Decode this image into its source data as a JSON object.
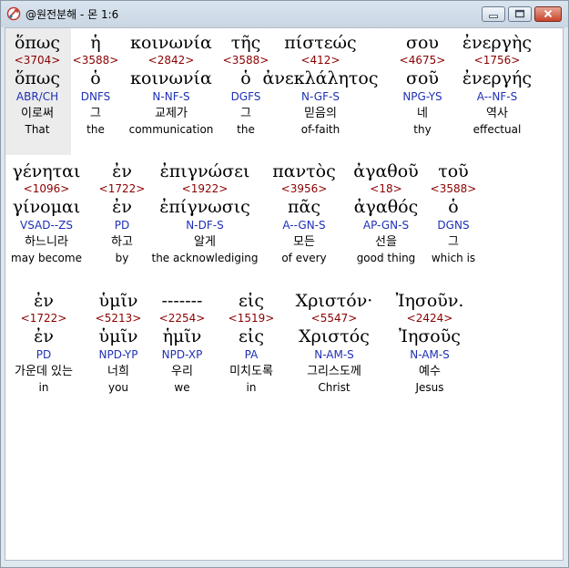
{
  "window": {
    "title": "@원전분해 - 몬 1:6",
    "colors": {
      "strong": "#8b0000",
      "parse": "#1f30b6",
      "highlight": "#ececec"
    }
  },
  "icons": [
    "app-icon",
    "minimize-icon",
    "maximize-icon",
    "close-icon"
  ],
  "rows": [
    {
      "words": [
        {
          "greek": "ὅπως",
          "strong": "<3704>",
          "lemma": "ὅπως",
          "parse": "ABR/CH",
          "korean": "이로써",
          "english": "That"
        },
        {
          "greek": "ἡ",
          "strong": "<3588>",
          "lemma": "ὁ",
          "parse": "DNFS",
          "korean": "그",
          "english": "the"
        },
        {
          "greek": "κοινωνία",
          "strong": "<2842>",
          "lemma": "κοινωνία",
          "parse": "N-NF-S",
          "korean": "교제가",
          "english": "communication"
        },
        {
          "greek": "τῆς",
          "strong": "<3588>",
          "lemma": "ὁ",
          "parse": "DGFS",
          "korean": "그",
          "english": "the"
        },
        {
          "greek": "πίστεώς",
          "strong": "<412>",
          "lemma": "ἀνεκλάλητος",
          "parse": "N-GF-S",
          "korean": "믿음의",
          "english": "of-faith"
        },
        {
          "greek": "σου",
          "strong": "<4675>",
          "lemma": "σοῦ",
          "parse": "NPG-YS",
          "korean": "네",
          "english": "thy"
        },
        {
          "greek": "ἐνεργὴς",
          "strong": "<1756>",
          "lemma": "ἐνεργής",
          "parse": "A--NF-S",
          "korean": "역사",
          "english": "effectual"
        }
      ]
    },
    {
      "words": [
        {
          "greek": "γένηται",
          "strong": "<1096>",
          "lemma": "γίνομαι",
          "parse": "VSAD--ZS",
          "korean": "하느니라",
          "english": "may become"
        },
        {
          "greek": "ἐν",
          "strong": "<1722>",
          "lemma": "ἐν",
          "parse": "PD",
          "korean": "하고",
          "english": "by"
        },
        {
          "greek": "ἐπιγνώσει",
          "strong": "<1922>",
          "lemma": "ἐπίγνωσις",
          "parse": "N-DF-S",
          "korean": "알게",
          "english": "the acknowlediging"
        },
        {
          "greek": "παντὸς",
          "strong": "<3956>",
          "lemma": "πᾶς",
          "parse": "A--GN-S",
          "korean": "모든",
          "english": "of every"
        },
        {
          "greek": "ἀγαθοῦ",
          "strong": "<18>",
          "lemma": "ἀγαθός",
          "parse": "AP-GN-S",
          "korean": "선을",
          "english": "good thing"
        },
        {
          "greek": "τοῦ",
          "strong": "<3588>",
          "lemma": "ὁ",
          "parse": "DGNS",
          "korean": "그",
          "english": "which is"
        }
      ]
    },
    {
      "words": [
        {
          "greek": "ἐν",
          "strong": "<1722>",
          "lemma": "ἐν",
          "parse": "PD",
          "korean": "가운데 있는",
          "english": "in"
        },
        {
          "greek": "ὑμῖν",
          "strong": "<5213>",
          "lemma": "ὑμῖν",
          "parse": "NPD-YP",
          "korean": "너희",
          "english": "you"
        },
        {
          "greek": "-------",
          "strong": "<2254>",
          "lemma": "ἡμῖν",
          "parse": "NPD-XP",
          "korean": "우리",
          "english": "we"
        },
        {
          "greek": "εἰς",
          "strong": "<1519>",
          "lemma": "εἰς",
          "parse": "PA",
          "korean": "미치도록",
          "english": "in"
        },
        {
          "greek": "Χριστόν·",
          "strong": "<5547>",
          "lemma": "Χριστός",
          "parse": "N-AM-S",
          "korean": "그리스도께",
          "english": "Christ"
        },
        {
          "greek": "Ἰησοῦν.",
          "strong": "<2424>",
          "lemma": "Ἰησοῦς",
          "parse": "N-AM-S",
          "korean": "예수",
          "english": "Jesus"
        }
      ]
    }
  ]
}
